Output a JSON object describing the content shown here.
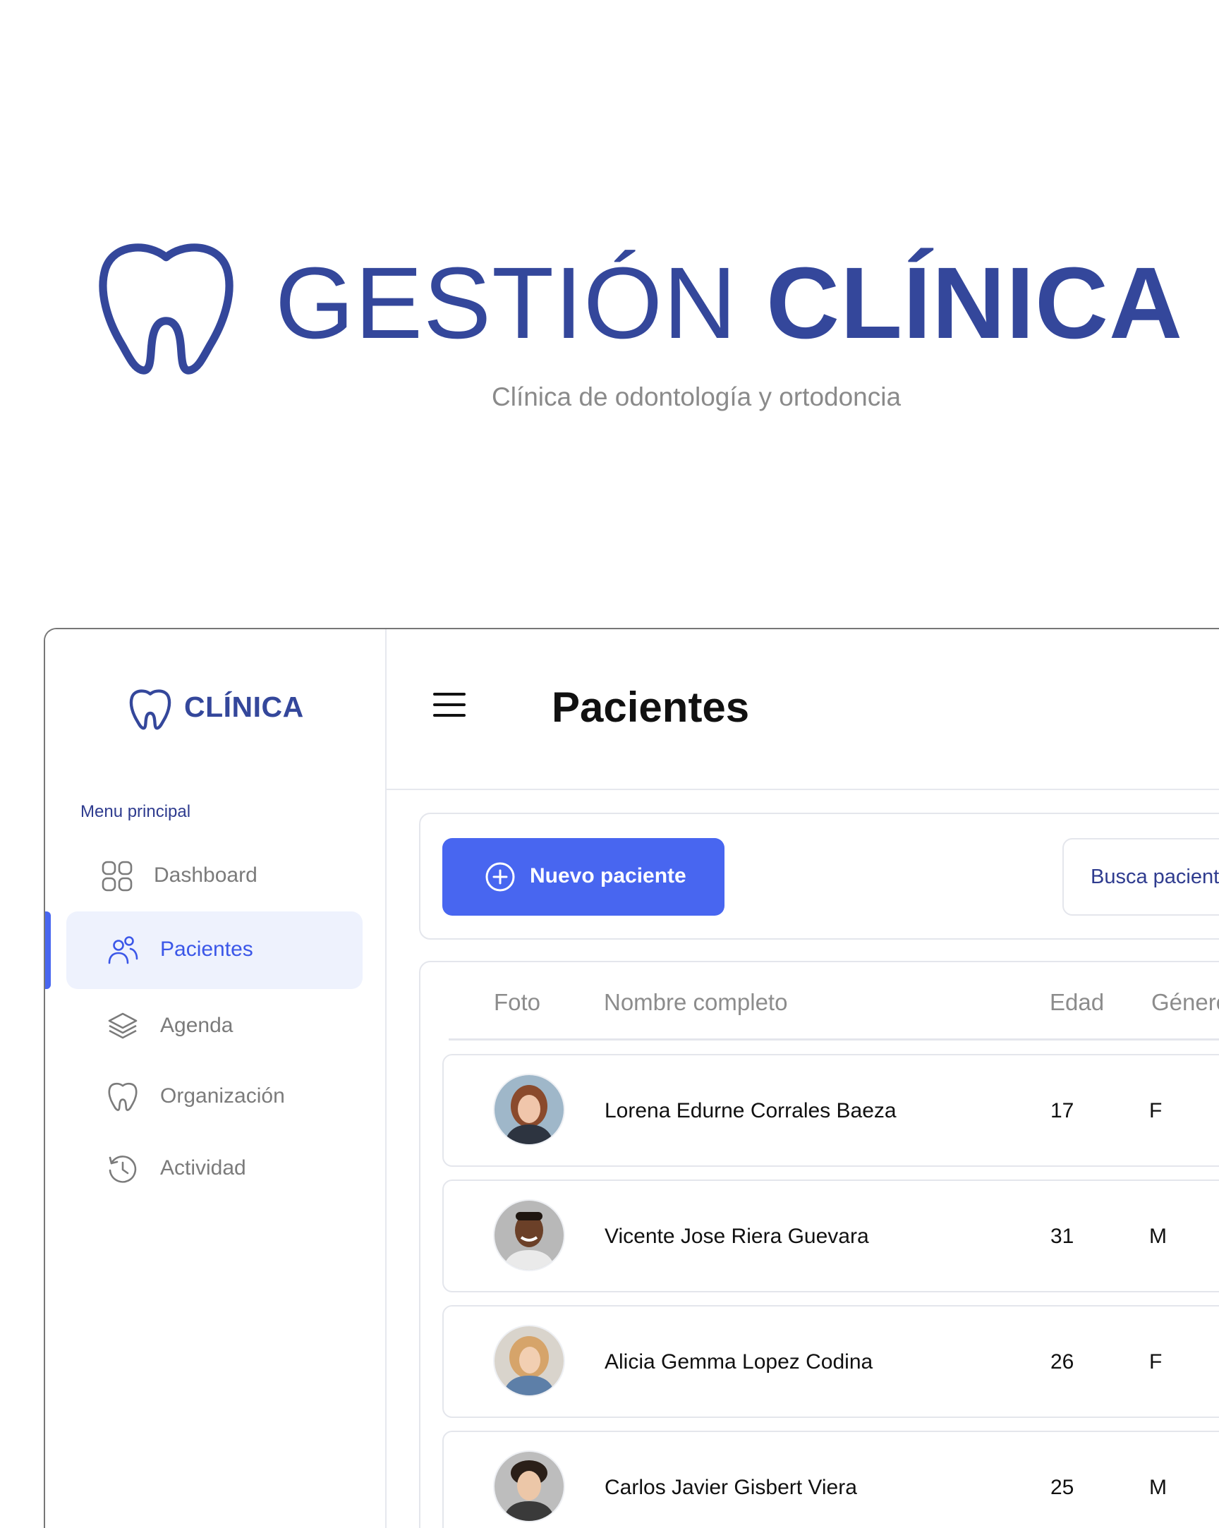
{
  "hero": {
    "title_light": "GESTIÓN",
    "title_bold": "CLÍNICA",
    "subtitle": "Clínica de odontología y ortodoncia",
    "brand_color": "#34479b",
    "logo_icon": "tooth-icon"
  },
  "sidebar": {
    "brand_name": "CLÍNICA",
    "menu_label": "Menu principal",
    "items": [
      {
        "label": "Dashboard",
        "icon": "grid-icon",
        "active": false
      },
      {
        "label": "Pacientes",
        "icon": "users-icon",
        "active": true
      },
      {
        "label": "Agenda",
        "icon": "layers-icon",
        "active": false
      },
      {
        "label": "Organización",
        "icon": "tooth-icon",
        "active": false
      },
      {
        "label": "Actividad",
        "icon": "history-icon",
        "active": false
      }
    ]
  },
  "header": {
    "title": "Pacientes",
    "menu_icon": "hamburger-icon"
  },
  "toolbar": {
    "new_label": "Nuevo paciente",
    "new_icon": "plus-circle-icon",
    "search_placeholder": "Busca paciente"
  },
  "table": {
    "columns": [
      "Foto",
      "Nombre completo",
      "Edad",
      "Género"
    ],
    "rows": [
      {
        "name": "Lorena Edurne Corrales Baeza",
        "age": "17",
        "gender": "F"
      },
      {
        "name": "Vicente Jose Riera Guevara",
        "age": "31",
        "gender": "M"
      },
      {
        "name": "Alicia Gemma Lopez Codina",
        "age": "26",
        "gender": "F"
      },
      {
        "name": "Carlos Javier Gisbert Viera",
        "age": "25",
        "gender": "M"
      }
    ]
  },
  "colors": {
    "accent": "#4866f0",
    "brand": "#34479b",
    "active_bg": "#eef2fd"
  }
}
